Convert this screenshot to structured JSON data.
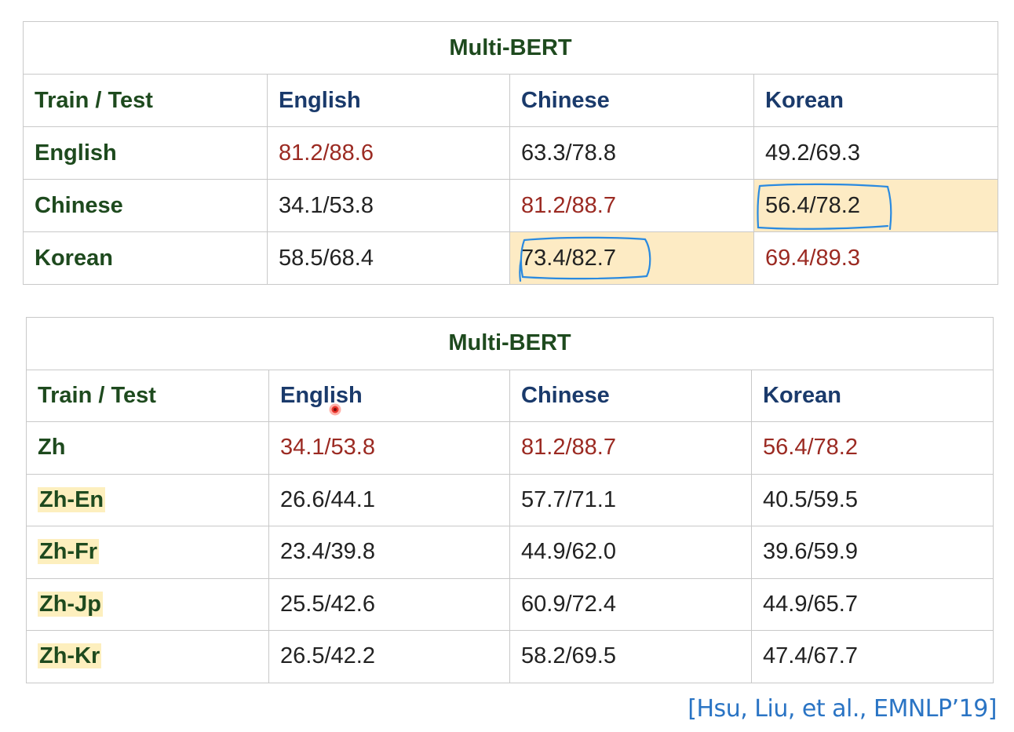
{
  "table1": {
    "title": "Multi-BERT",
    "header": [
      "Train / Test",
      "English",
      "Chinese",
      "Korean"
    ],
    "rows": [
      {
        "label": "English",
        "cells": [
          "81.2/88.6",
          "63.3/78.8",
          "49.2/69.3"
        ]
      },
      {
        "label": "Chinese",
        "cells": [
          "34.1/53.8",
          "81.2/88.7",
          "56.4/78.2"
        ]
      },
      {
        "label": "Korean",
        "cells": [
          "58.5/68.4",
          "73.4/82.7",
          "69.4/89.3"
        ]
      }
    ]
  },
  "table2": {
    "title": "Multi-BERT",
    "header": [
      "Train / Test",
      "English",
      "Chinese",
      "Korean"
    ],
    "rows": [
      {
        "label": "Zh",
        "cells": [
          "34.1/53.8",
          "81.2/88.7",
          "56.4/78.2"
        ]
      },
      {
        "label": "Zh-En",
        "cells": [
          "26.6/44.1",
          "57.7/71.1",
          "40.5/59.5"
        ]
      },
      {
        "label": "Zh-Fr",
        "cells": [
          "23.4/39.8",
          "44.9/62.0",
          "39.6/59.9"
        ]
      },
      {
        "label": "Zh-Jp",
        "cells": [
          "25.5/42.6",
          "60.9/72.4",
          "44.9/65.7"
        ]
      },
      {
        "label": "Zh-Kr",
        "cells": [
          "26.5/42.2",
          "58.2/69.5",
          "47.4/67.7"
        ]
      }
    ]
  },
  "citation": "[Hsu, Liu, et al., EMNLP’19]",
  "colors": {
    "title_green": "#1e4a1e",
    "header_blue": "#1a3a6b",
    "diag_red": "#9b2a22",
    "highlight": "#fdebc4",
    "annotation_blue": "#2a8ae0",
    "pointer_red": "#e8322a",
    "citation_blue": "#2a74c4"
  }
}
